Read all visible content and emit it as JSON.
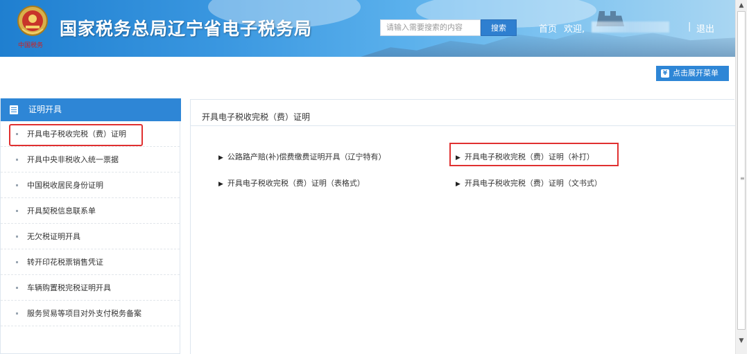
{
  "header": {
    "site_title": "国家税务总局辽宁省电子税务局",
    "search_placeholder": "请输入需要搜索的内容",
    "search_button": "搜索",
    "home_link": "首页",
    "welcome_text": "欢迎,",
    "separator": "|",
    "logout_link": "退出"
  },
  "toolbar": {
    "expand_menu_label": "点击展开菜单",
    "expand_menu_icon": "chevron-down-icon"
  },
  "sidebar": {
    "header_label": "证明开具",
    "header_icon": "document-icon",
    "items": [
      {
        "label": "开具电子税收完税（费）证明"
      },
      {
        "label": "开具中央非税收入统一票据"
      },
      {
        "label": "中国税收居民身份证明"
      },
      {
        "label": "开具契税信息联系单"
      },
      {
        "label": "无欠税证明开具"
      },
      {
        "label": "转开印花税票销售凭证"
      },
      {
        "label": "车辆购置税完税证明开具"
      },
      {
        "label": "服务贸易等项目对外支付税务备案"
      }
    ]
  },
  "main": {
    "title": "开具电子税收完税（费）证明",
    "links": [
      {
        "label": "公路路产赔(补)偿费缴费证明开具（辽宁特有）"
      },
      {
        "label": "开具电子税收完税（费）证明（补打）"
      },
      {
        "label": "开具电子税收完税（费）证明（表格式）"
      },
      {
        "label": "开具电子税收完税（费）证明（文书式）"
      }
    ],
    "arrow_glyph": "▶"
  },
  "colors": {
    "accent": "#2e86d6",
    "highlight": "#e03030"
  }
}
